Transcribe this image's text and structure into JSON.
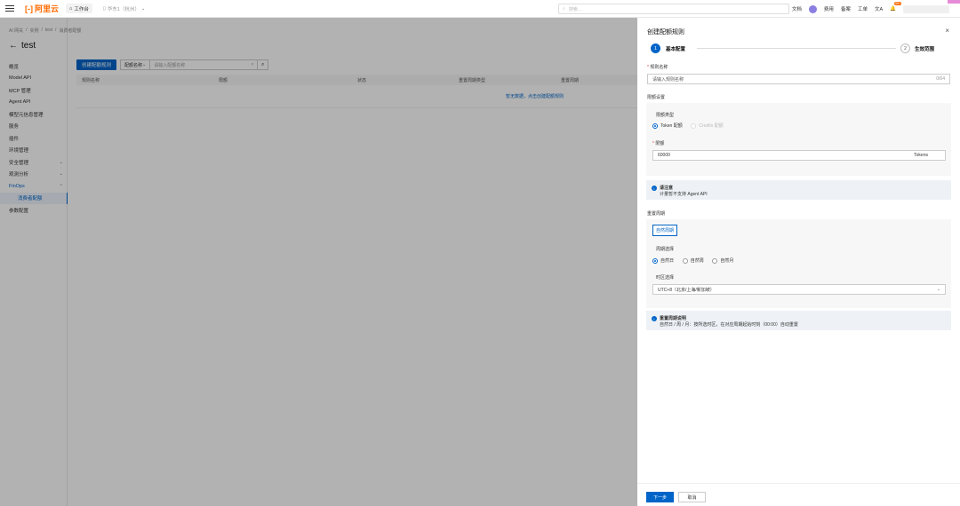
{
  "topbar": {
    "logo_text": "阿里云",
    "workbench": "工作台",
    "region": "华东1（杭州）",
    "search_placeholder": "搜索...",
    "nav_items": [
      "文档",
      "费用",
      "备案",
      "工单"
    ],
    "bell_badge": "99+"
  },
  "left": {
    "breadcrumb": [
      "AI 网关",
      "/",
      "实例",
      "/",
      "test",
      "/",
      "消费者配额"
    ],
    "page_title": "test",
    "nav": [
      {
        "label": "概览"
      },
      {
        "label": "Model API"
      },
      {
        "label": "MCP 管理"
      },
      {
        "label": "Agent API"
      },
      {
        "label": "模型元信息管理"
      },
      {
        "label": "服务"
      },
      {
        "label": "插件"
      },
      {
        "label": "环境管理"
      },
      {
        "label": "安全管理"
      },
      {
        "label": "观测分析"
      },
      {
        "label": "FinOps"
      },
      {
        "label": "消费者配额"
      },
      {
        "label": "参数配置"
      }
    ]
  },
  "main": {
    "create_button": "创建配额规则",
    "filter_select": "配额名称",
    "filter_placeholder": "请输入配额名称",
    "columns": [
      "规则名称",
      "限额",
      "状态",
      "重置周期类型",
      "重置周期"
    ],
    "empty_text": "暂无数据，点击创建配额规则"
  },
  "drawer": {
    "title": "创建配额规则",
    "steps": [
      {
        "num": "1",
        "label": "基本配置"
      },
      {
        "num": "2",
        "label": "生效范围"
      }
    ],
    "rule_name_label": "规则名称",
    "rule_name_placeholder": "请输入规则名称",
    "rule_name_count": "0/64",
    "limit_section": "限额设置",
    "limit_type_label": "限额类型",
    "limit_types": [
      "Token 配额",
      "Credits 配额"
    ],
    "limit_label": "限额",
    "limit_value": "60000",
    "limit_unit": "Tokens",
    "notice1_title": "请注意",
    "notice1_text": "计量暂不支持 Agent API",
    "reset_section": "重置周期",
    "reset_tab": "自然周期",
    "period_label": "周期选择",
    "periods": [
      "自然日",
      "自然周",
      "自然月"
    ],
    "timezone_label": "时区选择",
    "timezone_value": "UTC+8（北京/上海/新加坡）",
    "notice2_title": "重置周期说明",
    "notice2_text": "自然日 / 周 / 月：按所选时区，在对应周期起始时刻（00:00）自动重置",
    "next_button": "下一步",
    "cancel_button": "取消"
  }
}
